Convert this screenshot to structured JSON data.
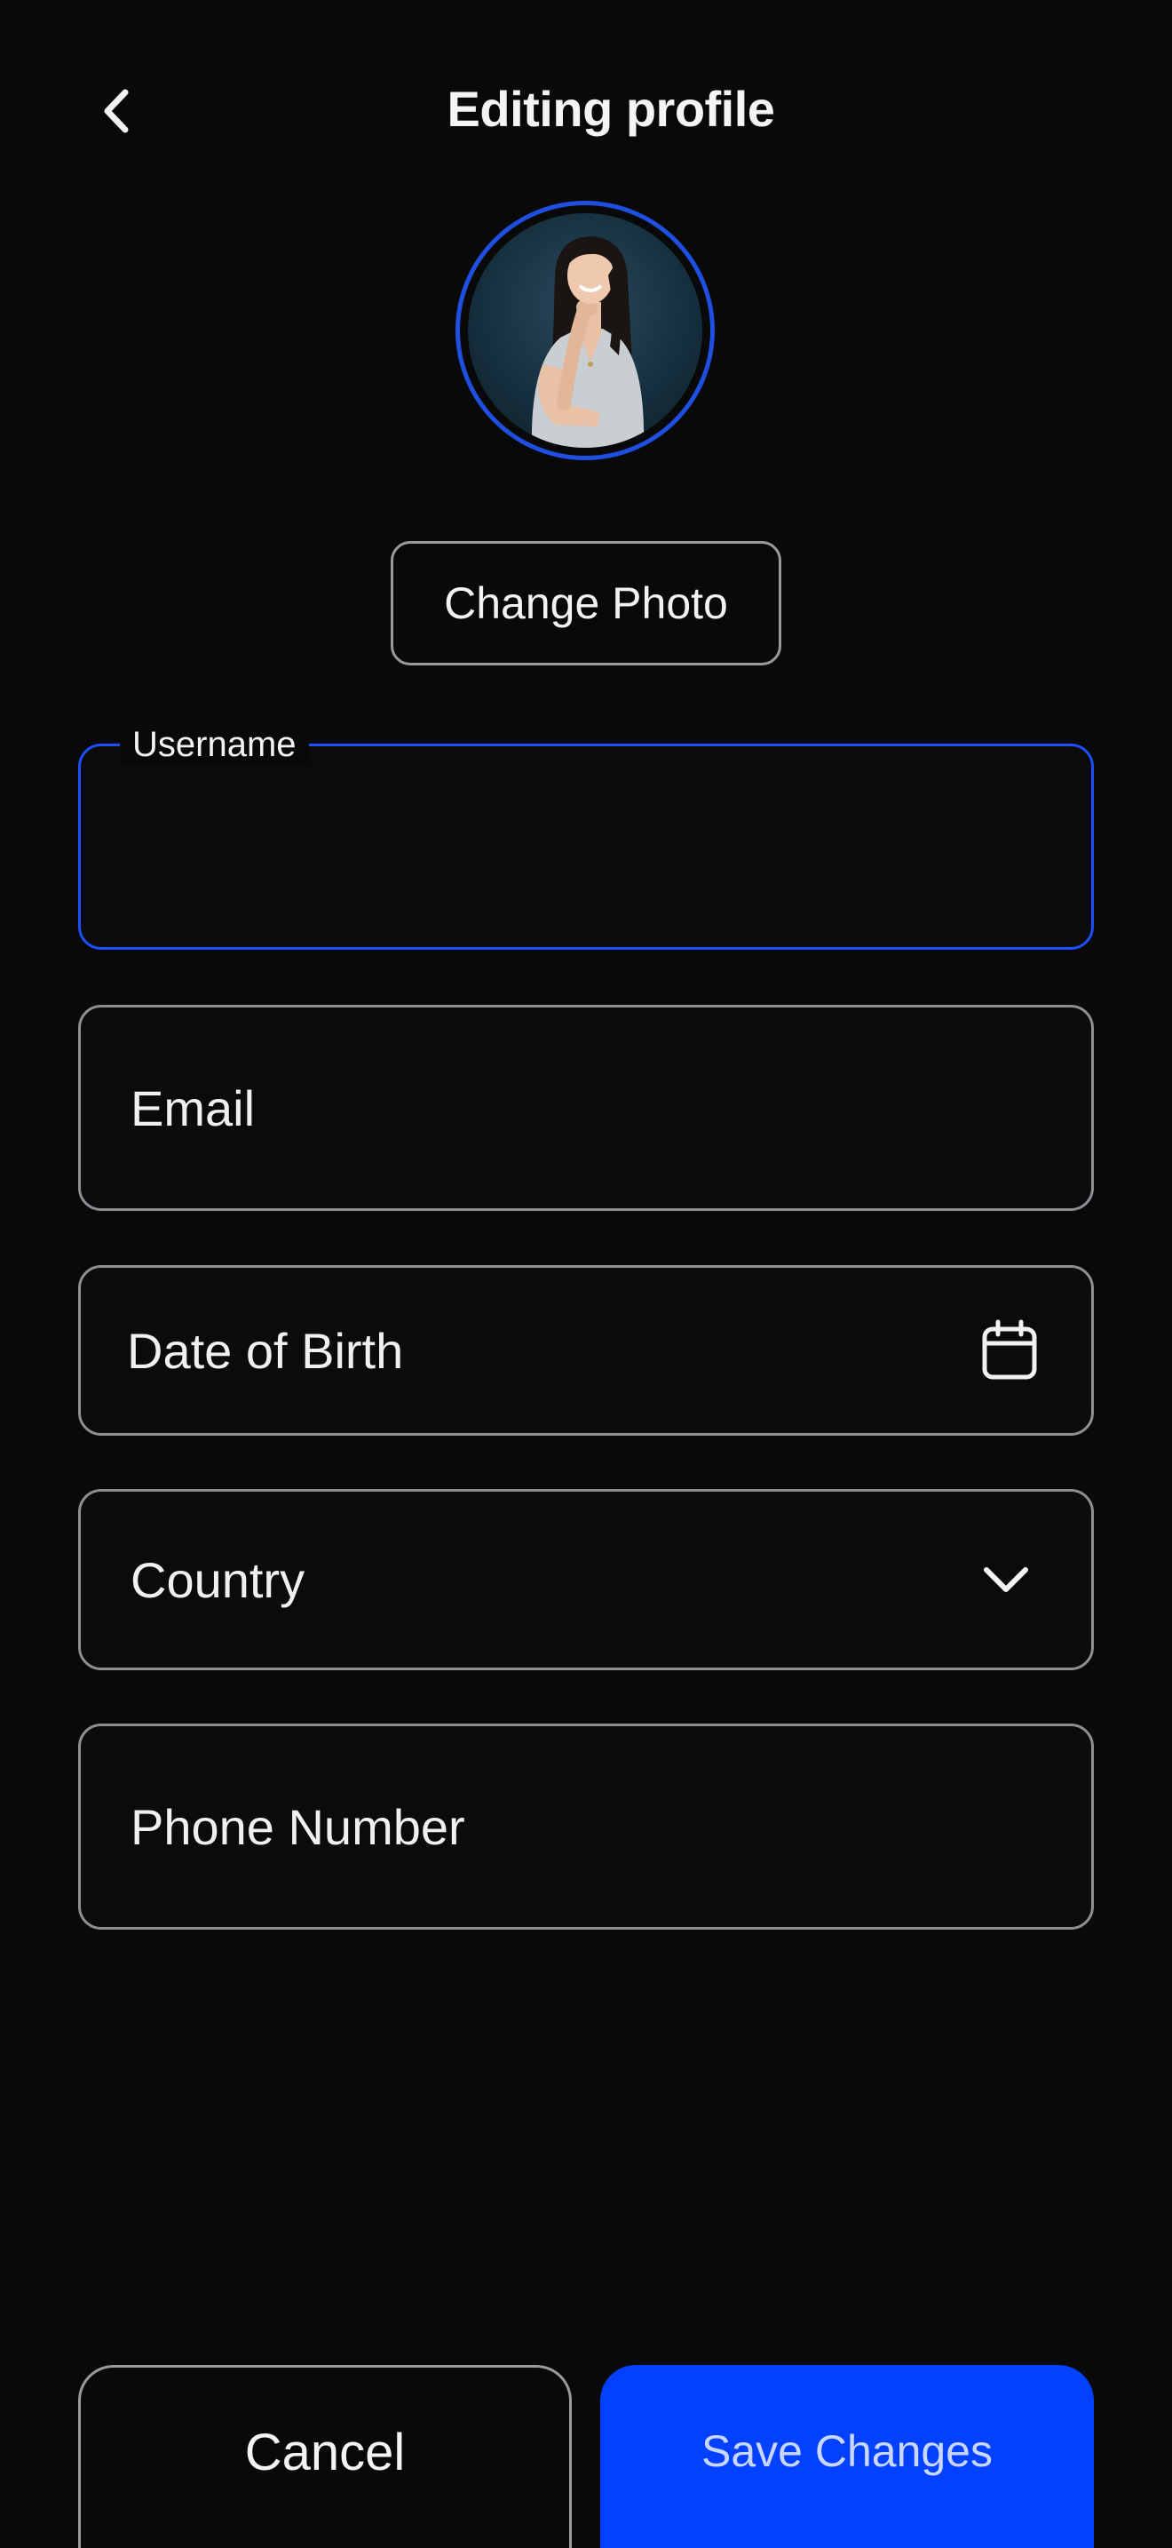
{
  "header": {
    "title": "Editing profile",
    "back_icon": "chevron-left-icon"
  },
  "profile": {
    "avatar_alt": "Profile photo",
    "change_photo_label": "Change Photo"
  },
  "form": {
    "username": {
      "label": "Username",
      "value": "",
      "placeholder": ""
    },
    "email": {
      "value": "",
      "placeholder": "Email"
    },
    "dob": {
      "value": "",
      "placeholder": "Date of Birth",
      "icon": "calendar-icon"
    },
    "country": {
      "value": "",
      "placeholder": "Country",
      "icon": "chevron-down-icon"
    },
    "phone": {
      "value": "",
      "placeholder": "Phone Number"
    }
  },
  "actions": {
    "cancel_label": "Cancel",
    "save_label": "Save Changes"
  },
  "colors": {
    "background": "#090909",
    "accent": "#0241ff",
    "focus_border": "#1b4fff",
    "field_border": "#8e8e94"
  }
}
